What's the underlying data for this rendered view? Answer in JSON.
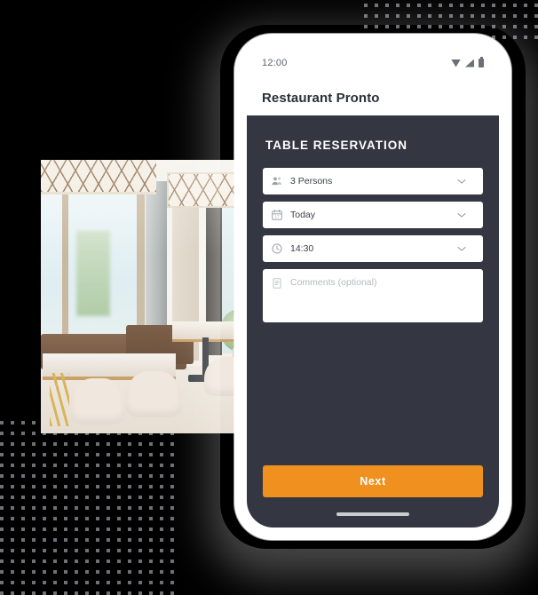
{
  "background": {
    "color": "#000000",
    "dot_color": "#6e7076",
    "dot_blocks": [
      "top-right",
      "bottom-left"
    ]
  },
  "photo": {
    "alt": "Restaurant interior with tables, cream chairs and brown banquette seating"
  },
  "phone": {
    "frame_color": "#ffffff",
    "status_bar": {
      "time": "12:00",
      "icons": [
        "wifi-icon",
        "signal-icon",
        "battery-icon"
      ]
    },
    "app_bar": {
      "title": "Restaurant Pronto"
    },
    "content": {
      "background_color": "#343642",
      "section_title": "TABLE RESERVATION",
      "fields": [
        {
          "icon": "people-icon",
          "value": "3 Persons",
          "chevron": "chevron-down-icon"
        },
        {
          "icon": "calendar-icon",
          "value": "Today",
          "chevron": "chevron-down-icon"
        },
        {
          "icon": "clock-icon",
          "value": "14:30",
          "chevron": "chevron-down-icon"
        }
      ],
      "comments": {
        "icon": "note-icon",
        "placeholder": "Comments (optional)",
        "value": ""
      },
      "primary_button": {
        "label": "Next",
        "color": "#f0901e"
      }
    },
    "home_indicator": true
  }
}
